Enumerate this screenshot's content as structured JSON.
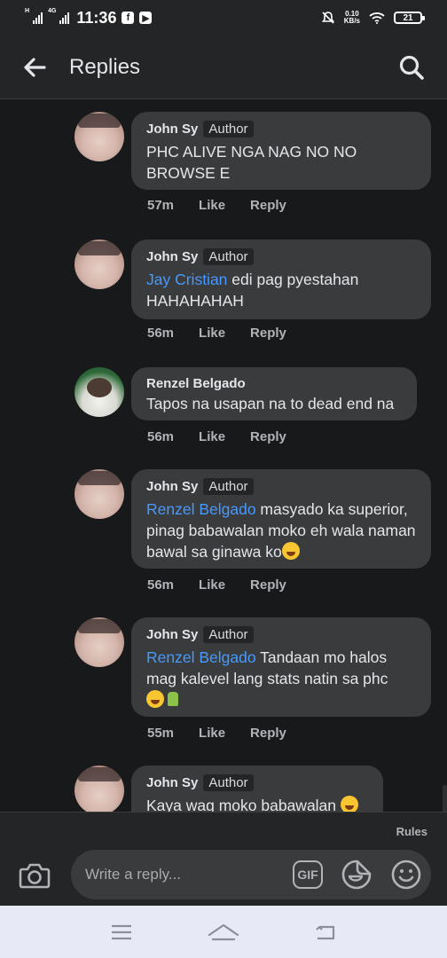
{
  "status_bar": {
    "network_label": "H",
    "network_label_2": "4G",
    "time": "11:36",
    "data_speed_value": "0.10",
    "data_speed_unit": "KB/s",
    "battery": "21",
    "colors": {
      "background": "#242526",
      "foreground": "#ffffff"
    }
  },
  "header": {
    "title": "Replies",
    "back_icon": "arrow-left-icon",
    "search_icon": "search-icon"
  },
  "comments": [
    {
      "author": "John Sy",
      "badge": "Author",
      "mention": "",
      "text": "PHC ALIVE NGA NAG NO NO BROWSE E",
      "time": "57m",
      "like": "Like",
      "reply": "Reply"
    },
    {
      "author": "John Sy",
      "badge": "Author",
      "mention": "Jay Cristian",
      "text": " edi pag pyestahan HAHAHAHAH",
      "time": "56m",
      "like": "Like",
      "reply": "Reply"
    },
    {
      "author": "Renzel Belgado",
      "badge": "",
      "mention": "",
      "text": "Tapos na usapan na to dead end na",
      "time": "56m",
      "like": "Like",
      "reply": "Reply"
    },
    {
      "author": "John Sy",
      "badge": "Author",
      "mention": "Renzel Belgado",
      "text": " masyado ka superior, pinag babawalan moko eh wala naman bawal sa ginawa ko",
      "time": "56m",
      "like": "Like",
      "reply": "Reply"
    },
    {
      "author": "John Sy",
      "badge": "Author",
      "mention": "Renzel Belgado",
      "text": " Tandaan mo halos mag kalevel lang stats natin sa phc",
      "time": "55m",
      "like": "Like",
      "reply": "Reply"
    },
    {
      "author": "John Sy",
      "badge": "Author",
      "mention": "",
      "text": "Kaya wag moko babawalan",
      "time": "",
      "like": "",
      "reply": ""
    }
  ],
  "composer": {
    "rules": "Rules",
    "placeholder": "Write a reply...",
    "gif": "GIF",
    "camera_icon": "camera-icon",
    "sticker_icon": "sticker-icon",
    "emoji_icon": "smiley-icon"
  },
  "nav": {
    "menu_icon": "menu-icon",
    "home_icon": "home-icon",
    "back_icon": "back-icon"
  },
  "colors": {
    "background": "#18191a",
    "bubble": "#3a3b3c",
    "mention": "#4599ff",
    "muted": "#b0b3b8",
    "navbar": "#e7eaf6"
  }
}
